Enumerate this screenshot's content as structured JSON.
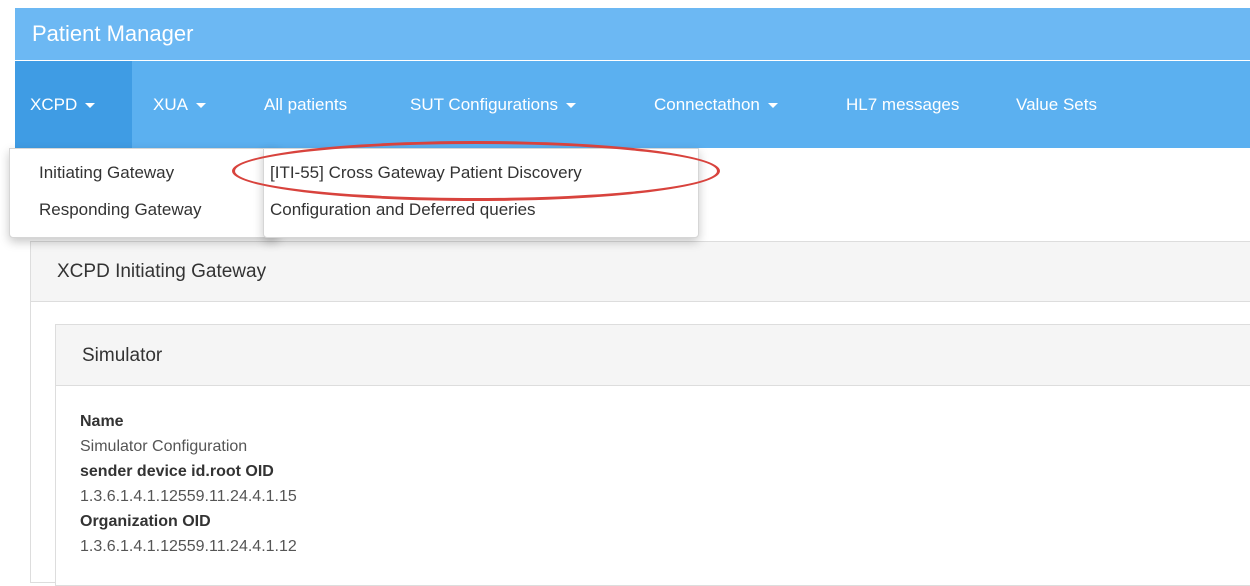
{
  "app": {
    "title": "Patient Manager"
  },
  "nav": {
    "items": [
      {
        "label": "XCPD",
        "has_caret": true
      },
      {
        "label": "XUA",
        "has_caret": true
      },
      {
        "label": "All patients",
        "has_caret": false
      },
      {
        "label": "SUT Configurations",
        "has_caret": true
      },
      {
        "label": "Connectathon",
        "has_caret": true
      },
      {
        "label": "HL7 messages",
        "has_caret": false
      },
      {
        "label": "Value Sets",
        "has_caret": false
      }
    ],
    "active": "XCPD"
  },
  "xcpd_menu": {
    "items": [
      {
        "label": "Initiating Gateway"
      },
      {
        "label": "Responding Gateway"
      }
    ]
  },
  "initiating_submenu": {
    "items": [
      {
        "label": "[ITI-55] Cross Gateway Patient Discovery"
      },
      {
        "label": "Configuration and Deferred queries"
      }
    ]
  },
  "page": {
    "panel_title": "XCPD Initiating Gateway",
    "simulator": {
      "title": "Simulator",
      "fields": [
        {
          "label": "Name",
          "value": "Simulator Configuration"
        },
        {
          "label": "sender device id.root OID",
          "value": "1.3.6.1.4.1.12559.11.24.4.1.15"
        },
        {
          "label": "Organization OID",
          "value": "1.3.6.1.4.1.12559.11.24.4.1.12"
        }
      ]
    }
  },
  "colors": {
    "brand_bar": "#6cb8f3",
    "nav_bar": "#5bb0f0",
    "nav_active": "#3f9ce4",
    "annotation": "#d8433d"
  }
}
